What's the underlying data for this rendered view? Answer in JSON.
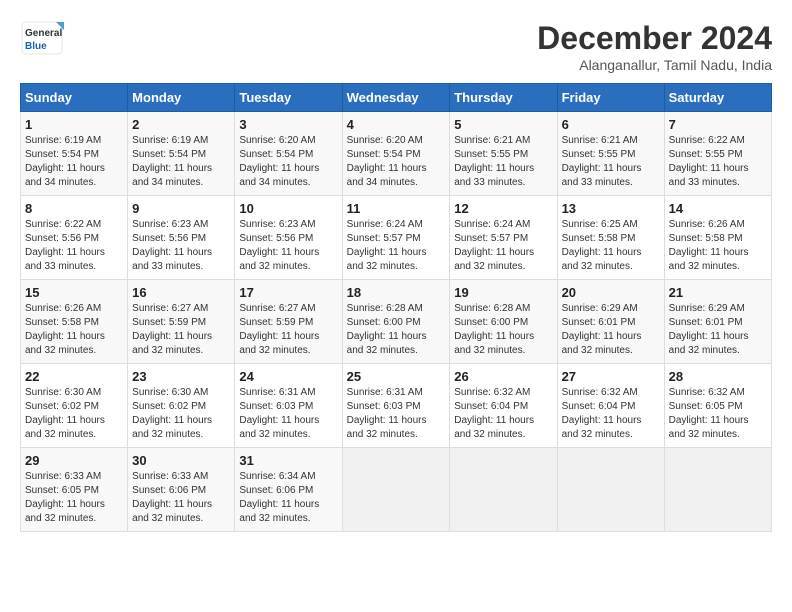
{
  "logo": {
    "line1": "General",
    "line2": "Blue"
  },
  "title": "December 2024",
  "location": "Alanganallur, Tamil Nadu, India",
  "days_of_week": [
    "Sunday",
    "Monday",
    "Tuesday",
    "Wednesday",
    "Thursday",
    "Friday",
    "Saturday"
  ],
  "weeks": [
    [
      {
        "day": "1",
        "sunrise": "6:19 AM",
        "sunset": "5:54 PM",
        "daylight": "11 hours and 34 minutes."
      },
      {
        "day": "2",
        "sunrise": "6:19 AM",
        "sunset": "5:54 PM",
        "daylight": "11 hours and 34 minutes."
      },
      {
        "day": "3",
        "sunrise": "6:20 AM",
        "sunset": "5:54 PM",
        "daylight": "11 hours and 34 minutes."
      },
      {
        "day": "4",
        "sunrise": "6:20 AM",
        "sunset": "5:54 PM",
        "daylight": "11 hours and 34 minutes."
      },
      {
        "day": "5",
        "sunrise": "6:21 AM",
        "sunset": "5:55 PM",
        "daylight": "11 hours and 33 minutes."
      },
      {
        "day": "6",
        "sunrise": "6:21 AM",
        "sunset": "5:55 PM",
        "daylight": "11 hours and 33 minutes."
      },
      {
        "day": "7",
        "sunrise": "6:22 AM",
        "sunset": "5:55 PM",
        "daylight": "11 hours and 33 minutes."
      }
    ],
    [
      {
        "day": "8",
        "sunrise": "6:22 AM",
        "sunset": "5:56 PM",
        "daylight": "11 hours and 33 minutes."
      },
      {
        "day": "9",
        "sunrise": "6:23 AM",
        "sunset": "5:56 PM",
        "daylight": "11 hours and 33 minutes."
      },
      {
        "day": "10",
        "sunrise": "6:23 AM",
        "sunset": "5:56 PM",
        "daylight": "11 hours and 32 minutes."
      },
      {
        "day": "11",
        "sunrise": "6:24 AM",
        "sunset": "5:57 PM",
        "daylight": "11 hours and 32 minutes."
      },
      {
        "day": "12",
        "sunrise": "6:24 AM",
        "sunset": "5:57 PM",
        "daylight": "11 hours and 32 minutes."
      },
      {
        "day": "13",
        "sunrise": "6:25 AM",
        "sunset": "5:58 PM",
        "daylight": "11 hours and 32 minutes."
      },
      {
        "day": "14",
        "sunrise": "6:26 AM",
        "sunset": "5:58 PM",
        "daylight": "11 hours and 32 minutes."
      }
    ],
    [
      {
        "day": "15",
        "sunrise": "6:26 AM",
        "sunset": "5:58 PM",
        "daylight": "11 hours and 32 minutes."
      },
      {
        "day": "16",
        "sunrise": "6:27 AM",
        "sunset": "5:59 PM",
        "daylight": "11 hours and 32 minutes."
      },
      {
        "day": "17",
        "sunrise": "6:27 AM",
        "sunset": "5:59 PM",
        "daylight": "11 hours and 32 minutes."
      },
      {
        "day": "18",
        "sunrise": "6:28 AM",
        "sunset": "6:00 PM",
        "daylight": "11 hours and 32 minutes."
      },
      {
        "day": "19",
        "sunrise": "6:28 AM",
        "sunset": "6:00 PM",
        "daylight": "11 hours and 32 minutes."
      },
      {
        "day": "20",
        "sunrise": "6:29 AM",
        "sunset": "6:01 PM",
        "daylight": "11 hours and 32 minutes."
      },
      {
        "day": "21",
        "sunrise": "6:29 AM",
        "sunset": "6:01 PM",
        "daylight": "11 hours and 32 minutes."
      }
    ],
    [
      {
        "day": "22",
        "sunrise": "6:30 AM",
        "sunset": "6:02 PM",
        "daylight": "11 hours and 32 minutes."
      },
      {
        "day": "23",
        "sunrise": "6:30 AM",
        "sunset": "6:02 PM",
        "daylight": "11 hours and 32 minutes."
      },
      {
        "day": "24",
        "sunrise": "6:31 AM",
        "sunset": "6:03 PM",
        "daylight": "11 hours and 32 minutes."
      },
      {
        "day": "25",
        "sunrise": "6:31 AM",
        "sunset": "6:03 PM",
        "daylight": "11 hours and 32 minutes."
      },
      {
        "day": "26",
        "sunrise": "6:32 AM",
        "sunset": "6:04 PM",
        "daylight": "11 hours and 32 minutes."
      },
      {
        "day": "27",
        "sunrise": "6:32 AM",
        "sunset": "6:04 PM",
        "daylight": "11 hours and 32 minutes."
      },
      {
        "day": "28",
        "sunrise": "6:32 AM",
        "sunset": "6:05 PM",
        "daylight": "11 hours and 32 minutes."
      }
    ],
    [
      {
        "day": "29",
        "sunrise": "6:33 AM",
        "sunset": "6:05 PM",
        "daylight": "11 hours and 32 minutes."
      },
      {
        "day": "30",
        "sunrise": "6:33 AM",
        "sunset": "6:06 PM",
        "daylight": "11 hours and 32 minutes."
      },
      {
        "day": "31",
        "sunrise": "6:34 AM",
        "sunset": "6:06 PM",
        "daylight": "11 hours and 32 minutes."
      },
      null,
      null,
      null,
      null
    ]
  ]
}
